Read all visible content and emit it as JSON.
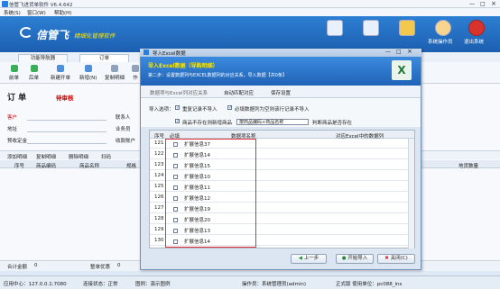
{
  "app": {
    "title": "信管飞进货单软件 V6.4.642"
  },
  "menu": [
    "系统(S)",
    "窗口(W)",
    "帮助(H)"
  ],
  "banner": {
    "logo": "信管飞",
    "slogan": "精细化管理软件",
    "icons": [
      "",
      "",
      "",
      "",
      "系统操作员",
      "退出系统"
    ]
  },
  "tabs": [
    "功能导航器",
    "订单"
  ],
  "toolbar": [
    "前单",
    "后单",
    "新建开单",
    "新增(N)",
    "复制明细",
    "作"
  ],
  "order": {
    "title": "订 单",
    "status": "待审核",
    "fields_left": [
      "客户",
      "地址",
      "预收定金"
    ],
    "fields_right": [
      "联系人",
      "业务员",
      "收款账户"
    ]
  },
  "detail_toolbar": [
    "添加明细",
    "复制明细",
    "删除明细",
    "扫码"
  ],
  "grid_headers": [
    "序号",
    "商品编码",
    "商品名称",
    "规格",
    "地货数量"
  ],
  "bottom": {
    "total_label": "合计金额",
    "total_value": "0",
    "discount_label": "整单优惠",
    "discount_value": "0"
  },
  "statusbar": {
    "server": "应用中心：127.0.0.1:7080",
    "conn": "连接状态：正常",
    "user_label": "操作员：系统管理员(admin)",
    "edition": "正式版 使用单位：pc088_ins",
    "demo": "图例：演示图例"
  },
  "dialog": {
    "title": "导入Excel数据",
    "head_title": "导入Excel数据（导购明细）",
    "head_sub": "第二步：设置数据列与EXCEL数据列的对应关系，导入数据【共0条】",
    "steps": [
      "数据项与Excel列对应关系",
      "自动匹配对应",
      "保存设置"
    ],
    "options": {
      "label": "导入选项：",
      "opt1": "重复记录不导入",
      "opt2": "必填数据列为空则该行记录不导入",
      "opt3": "商品不存在则新增商品",
      "select_value": "按商品编码+商品名称",
      "opt4": "判断商品是否存在"
    },
    "table_headers": [
      "序号",
      "必填",
      "数据项名称",
      "对应Excel中的数据列"
    ],
    "rows": [
      {
        "no": "121",
        "name": "扩展信息37"
      },
      {
        "no": "122",
        "name": "扩展信息14"
      },
      {
        "no": "123",
        "name": "扩展信息15"
      },
      {
        "no": "124",
        "name": "扩展信息10"
      },
      {
        "no": "125",
        "name": "扩展信息11"
      },
      {
        "no": "126",
        "name": "扩展信息12"
      },
      {
        "no": "127",
        "name": "扩展信息19"
      },
      {
        "no": "128",
        "name": "扩展信息20"
      },
      {
        "no": "129",
        "name": "扩展信息13"
      },
      {
        "no": "130",
        "name": "扩展信息14"
      }
    ],
    "buttons": [
      "上一步",
      "开始导入",
      "关闭(C)"
    ]
  }
}
